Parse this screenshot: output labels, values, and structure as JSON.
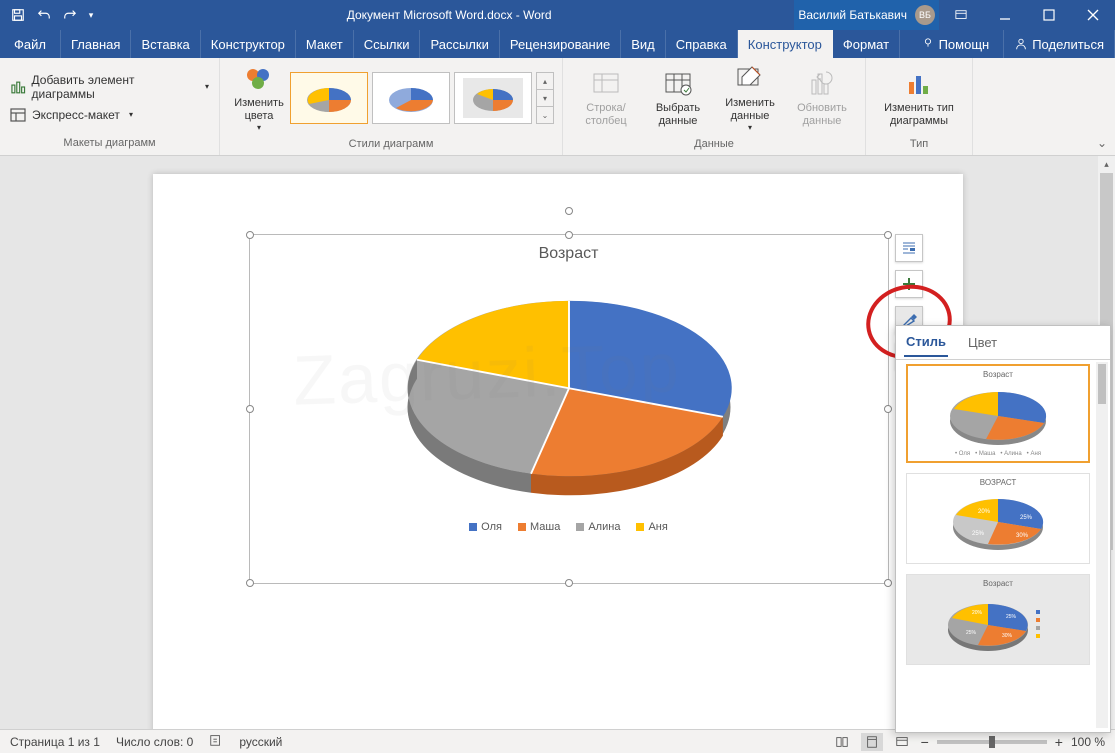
{
  "titlebar": {
    "document_title": "Документ Microsoft Word.docx  -  Word",
    "user_name": "Василий Батькавич",
    "user_initials": "ВБ"
  },
  "tabs": {
    "file": "Файл",
    "home": "Главная",
    "insert": "Вставка",
    "designer": "Конструктор",
    "layout": "Макет",
    "references": "Ссылки",
    "mailings": "Рассылки",
    "review": "Рецензирование",
    "view": "Вид",
    "help": "Справка",
    "chart_design": "Конструктор",
    "format": "Формат",
    "assist": "Помощн",
    "share": "Поделиться"
  },
  "ribbon": {
    "add_element": "Добавить элемент диаграммы",
    "express_layout": "Экспресс-макет",
    "layouts_label": "Макеты диаграмм",
    "change_colors": "Изменить цвета",
    "styles_label": "Стили диаграмм",
    "row_col": "Строка/ столбец",
    "select_data": "Выбрать данные",
    "edit_data": "Изменить данные",
    "refresh_data": "Обновить данные",
    "data_label": "Данные",
    "change_type": "Изменить тип диаграммы",
    "type_label": "Тип"
  },
  "style_pane": {
    "tab_style": "Стиль",
    "tab_color": "Цвет",
    "thumb2_title": "ВОЗРАСТ",
    "thumb3_title": "Возраст"
  },
  "statusbar": {
    "page": "Страница 1 из 1",
    "words": "Число слов: 0",
    "lang": "русский",
    "zoom": "100 %"
  },
  "chart_data": {
    "type": "pie",
    "title": "Возраст",
    "categories": [
      "Оля",
      "Маша",
      "Алина",
      "Аня"
    ],
    "values": [
      25,
      30,
      25,
      20
    ],
    "colors": [
      "#4472c4",
      "#ed7d31",
      "#a5a5a5",
      "#ffc000"
    ]
  }
}
